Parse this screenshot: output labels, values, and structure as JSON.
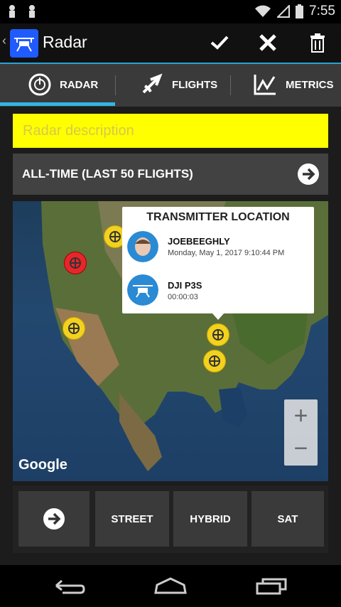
{
  "status_bar": {
    "time": "7:55"
  },
  "action_bar": {
    "title": "Radar"
  },
  "tabs": [
    {
      "label": "RADAR",
      "icon": "radar-icon"
    },
    {
      "label": "FLIGHTS",
      "icon": "airplane-icon"
    },
    {
      "label": "METRICS",
      "icon": "chart-icon"
    }
  ],
  "description": {
    "placeholder": "Radar description",
    "value": ""
  },
  "period": {
    "label": "ALL-TIME (LAST 50 FLIGHTS)"
  },
  "popup": {
    "title": "TRANSMITTER LOCATION",
    "pilot_name": "JOEBEEGHLY",
    "pilot_date": "Monday, May 1, 2017 9:10:44 PM",
    "aircraft_name": "DJI P3S",
    "aircraft_time": "00:00:03"
  },
  "map": {
    "attribution": "Google",
    "zoom_in": "+",
    "zoom_out": "−"
  },
  "map_buttons": {
    "street": "STREET",
    "hybrid": "HYBRID",
    "sat": "SAT"
  },
  "colors": {
    "accent": "#33b5e5",
    "description_bg": "#ffff00",
    "marker_yellow": "#f2d21e",
    "marker_red": "#e8262a"
  }
}
